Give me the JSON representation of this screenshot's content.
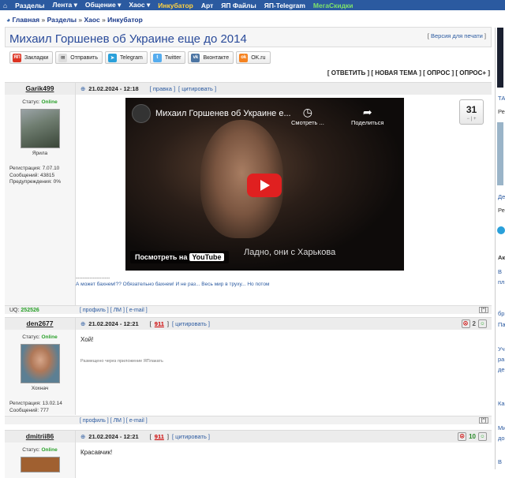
{
  "nav": {
    "items": [
      "Разделы",
      "Лента ▾",
      "Общение ▾",
      "Хаос ▾",
      "Инкубатор",
      "Арт",
      "ЯП Файлы",
      "ЯП-Telegram",
      "МегаСкидки"
    ]
  },
  "breadcrumbs": [
    "Главная",
    "Разделы",
    "Хаос",
    "Инкубатор"
  ],
  "page": {
    "title": "Михаил Горшенев об Украине еще до 2014",
    "print_link": "Версия для печати"
  },
  "share": {
    "buttons": [
      "Закладки",
      "Отправить",
      "Telegram",
      "Twitter",
      "Вконтакте",
      "OK.ru"
    ]
  },
  "actions": "[ ОТВЕТИТЬ ] [ НОВАЯ ТЕМА ] [ ОПРОС ] [ ОПРОС+ ]",
  "posts": [
    {
      "author": "Garik499",
      "status_label": "Статус:",
      "status": "Online",
      "nick": "Ярила",
      "stats": [
        "Регистрация: 7.07.10",
        "Сообщений: 43815",
        "Предупреждения: 0%"
      ],
      "date": "21.02.2024 - 12:18",
      "links": [
        "[ правка ]",
        "[ цитировать ]"
      ],
      "rating": "31",
      "video": {
        "title": "Михаил Горшенев об Украине е...",
        "watch_later": "Смотреть ...",
        "share": "Поделиться",
        "subtitle": "Ладно, они с Харькова",
        "watch_on": "Посмотреть на",
        "youtube": "YouTube"
      },
      "signature_dash": "--------------------",
      "signature": "А может бахнем!?? Обязательно бахнем! И не раз... Весь мир в труху... Но потом",
      "uq_label": "UQ:",
      "uq_value": "252526"
    },
    {
      "author": "den2677",
      "status_label": "Статус:",
      "status": "Online",
      "nick": "Хохнач",
      "stats": [
        "Регистрация: 13.02.14",
        "Сообщений: 777"
      ],
      "date": "21.02.2024 - 12:21",
      "rep": "911",
      "links": [
        "[ цитировать ]"
      ],
      "rate_value": "2",
      "text": "Хой!",
      "via": "Размещено через приложение ЯПлакать"
    },
    {
      "author": "dmitrii86",
      "status_label": "Статус:",
      "status": "Online",
      "date": "21.02.2024 - 12:21",
      "rep": "911",
      "links": [
        "[ цитировать ]"
      ],
      "rate_value": "10",
      "text": "Красавчик!"
    }
  ],
  "footer_links": "[ профиль ] [ ЛМ ] [ e-mail ]",
  "sidebar_fragments": [
    "ТА",
    "Ре",
    "Де",
    "Ре",
    "Ак",
    "В",
    "пл",
    "бр",
    "Па",
    "Уч",
    "ра",
    "де",
    "Ка",
    "Ми",
    "до",
    "В"
  ]
}
